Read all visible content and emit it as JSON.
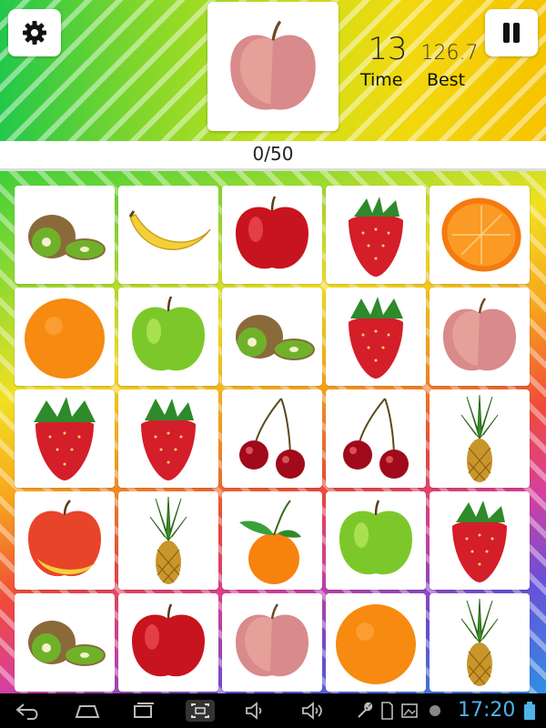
{
  "header": {
    "time_value": "13",
    "time_label": "Time",
    "best_value": "126.7",
    "best_label": "Best",
    "target_fruit": "apple-pink"
  },
  "progress": {
    "text": "0/50"
  },
  "grid": {
    "rows": [
      [
        "kiwi",
        "banana",
        "apple-red",
        "strawberry",
        "orange-slice"
      ],
      [
        "orange",
        "apple-green",
        "kiwi",
        "strawberry",
        "apple-pink"
      ],
      [
        "strawberry",
        "strawberry",
        "cherries",
        "cherries",
        "pineapple"
      ],
      [
        "apple-yellow-red",
        "pineapple",
        "tangerine",
        "apple-green",
        "strawberry"
      ],
      [
        "kiwi",
        "apple-red",
        "apple-pink",
        "orange",
        "pineapple"
      ]
    ]
  },
  "status_bar": {
    "clock": "17:20"
  },
  "colors": {
    "clock": "#4fb3e8"
  }
}
